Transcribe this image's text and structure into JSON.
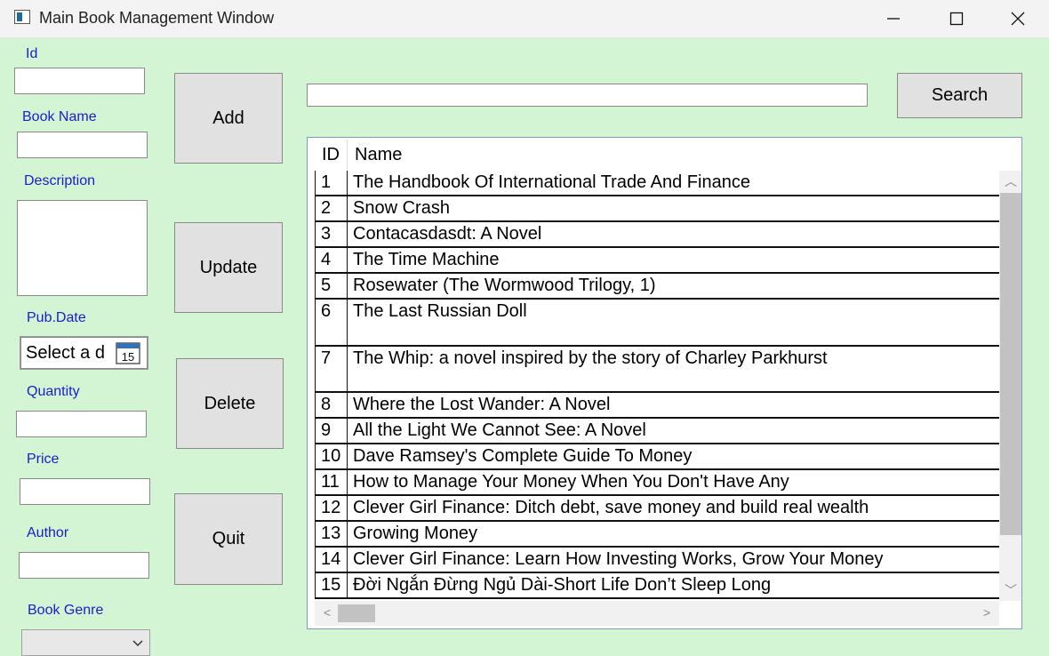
{
  "window": {
    "title": "Main Book Management Window"
  },
  "form": {
    "id_label": "Id",
    "book_name_label": "Book Name",
    "description_label": "Description",
    "pub_date_label": "Pub.Date",
    "pub_date_placeholder": "Select a d",
    "calendar_icon_day": "15",
    "quantity_label": "Quantity",
    "price_label": "Price",
    "author_label": "Author",
    "genre_label": "Book Genre"
  },
  "buttons": {
    "add": "Add",
    "update": "Update",
    "delete": "Delete",
    "quit": "Quit",
    "search": "Search"
  },
  "search": {
    "value": ""
  },
  "grid": {
    "columns": [
      "ID",
      "Name"
    ],
    "rows": [
      {
        "id": "1",
        "name": "The Handbook Of International Trade And Finance"
      },
      {
        "id": "2",
        "name": "Snow Crash"
      },
      {
        "id": "3",
        "name": "Contacasdasdt: A Novel"
      },
      {
        "id": "4",
        "name": "The Time Machine"
      },
      {
        "id": "5",
        "name": "Rosewater (The Wormwood Trilogy, 1)"
      },
      {
        "id": "6",
        "name": "The Last Russian Doll"
      },
      {
        "id": "7",
        "name": "The Whip: a novel inspired by the story of Charley Parkhurst"
      },
      {
        "id": "8",
        "name": "Where the Lost Wander: A Novel"
      },
      {
        "id": "9",
        "name": "All the Light We Cannot See: A Novel"
      },
      {
        "id": "10",
        "name": "Dave Ramsey's Complete Guide To Money"
      },
      {
        "id": "11",
        "name": "How to Manage Your Money When You Don't Have Any"
      },
      {
        "id": "12",
        "name": "Clever Girl Finance: Ditch debt, save money and build real wealth"
      },
      {
        "id": "13",
        "name": "Growing Money"
      },
      {
        "id": "14",
        "name": "Clever Girl Finance: Learn How Investing Works, Grow Your Money"
      },
      {
        "id": "15",
        "name": "Đời Ngắn Đừng Ngủ Dài-Short Life Don’t Sleep Long"
      }
    ]
  }
}
